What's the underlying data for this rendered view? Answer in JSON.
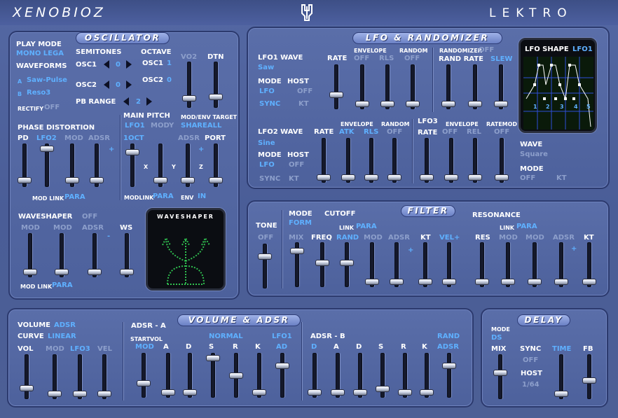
{
  "header": {
    "logo": "XENOBIOZ",
    "brand": "LEKTRO"
  },
  "osc": {
    "title": "OSCILLATOR",
    "play_mode": "PLAY MODE",
    "play_mode_val": "MONO LEGA",
    "waveforms": "WAVEFORMS",
    "wave_a_key": "A",
    "wave_a": "Saw-Pulse",
    "wave_b_key": "B",
    "wave_b": "Reso3",
    "rectify": "RECTIFY",
    "rectify_val": "OFF",
    "semitones": "SEMITONES",
    "octave": "OCTAVE",
    "osc1": "OSC1",
    "osc2": "OSC2",
    "osc1_semi": "0",
    "osc2_semi": "0",
    "osc1_oct": "1",
    "osc2_oct": "0",
    "pb_range": "PB RANGE",
    "pb_val": "2",
    "vo2": "VO2",
    "dtn": "DTN",
    "main_pitch": "MAIN PITCH",
    "mp_lfo": "LFO1",
    "mp_mody": "MODY",
    "mod_env_target": "MOD/ENV TARGET",
    "mod_env_val": "SHAREALL",
    "oct1": "1OCT",
    "adsr": "ADSR",
    "port": "PORT",
    "x": "X",
    "y": "Y",
    "z": "Z",
    "plus": "+",
    "modlink": "MODLINK",
    "modlink_val": "PARA",
    "env": "ENV",
    "env_val": "IN",
    "phase_dist": "PHASE DISTORTION",
    "pd": "PD",
    "pd_lfo": "LFO2",
    "pd_mod": "MOD",
    "pd_adsr": "ADSR",
    "pd_modlink": "MOD LINK",
    "pd_modlink_val": "PARA",
    "waveshaper": "WAVESHAPER",
    "ws_off": "OFF",
    "ws_mod1": "MOD",
    "ws_mod2": "MOD",
    "ws_adsr": "ADSR",
    "ws": "WS",
    "minus": "-",
    "ws_modlink": "MOD LINK",
    "ws_modlink_val": "PARA",
    "ws_display": "WAVESHAPER"
  },
  "lfo": {
    "title": "LFO & RANDOMIZER",
    "lfo1_wave": "LFO1 WAVE",
    "lfo1_wave_val": "Saw",
    "rate": "RATE",
    "envelope": "ENVELOPE",
    "random": "RANDOM",
    "env_off": "OFF",
    "rls": "RLS",
    "rnd_off": "OFF",
    "randomizer": "RANDOMIZER",
    "randomizer_val": "OFF",
    "rand_rate": "RAND RATE",
    "slew": "SLEW",
    "mode": "MODE",
    "host": "HOST",
    "mode_val": "LFO",
    "host_val": "OFF",
    "sync": "SYNC",
    "kt": "KT",
    "lfo2_wave": "LFO2 WAVE",
    "lfo2_wave_val": "Sine",
    "atk": "ATK",
    "rls2": "RLS",
    "off2": "OFF",
    "lfo3": "LFO3",
    "envelope3": "ENVELOPE",
    "ratemod": "RATEMOD",
    "lfo3_off1": "OFF",
    "lfo3_rel": "REL",
    "lfo3_off2": "OFF",
    "wave": "WAVE",
    "wave_val": "Square",
    "mode3": "MODE",
    "mode3_off": "OFF",
    "kt3": "KT",
    "shape_label": "LFO SHAPE",
    "shape_sel": "LFO1",
    "shape_nums": [
      "1",
      "2",
      "3",
      "4",
      "5"
    ]
  },
  "filter": {
    "title": "FILTER",
    "tone": "TONE",
    "tone_off": "OFF",
    "mode": "MODE",
    "mode_val": "FORM",
    "cutoff": "CUTOFF",
    "link": "LINK",
    "link_val": "PARA",
    "resonance": "RESONANCE",
    "res_link": "LINK",
    "res_link_val": "PARA",
    "mix": "MIX",
    "freq": "FREQ",
    "rand": "RAND",
    "mod": "MOD",
    "adsr": "ADSR",
    "kt": "KT",
    "velp": "VEL+",
    "res": "RES",
    "mod1": "MOD",
    "mod2": "MOD",
    "adsr2": "ADSR",
    "kt2": "KT"
  },
  "vol": {
    "title": "VOLUME & ADSR",
    "volume": "VOLUME",
    "volume_val": "ADSR",
    "curve": "CURVE",
    "curve_val": "LINEAR",
    "vol": "VOL",
    "mod": "MOD",
    "lfo3": "LFO3",
    "vel": "VEL",
    "adsr_a": "ADSR - A",
    "startvol": "STARTVOL",
    "normal": "NORMAL",
    "lfo1": "LFO1",
    "mod2": "MOD",
    "a": "A",
    "d": "D",
    "s": "S",
    "r": "R",
    "k": "K",
    "ad": "AD",
    "adsr_b": "ADSR - B",
    "rand": "RAND",
    "adsr_v": "ADSR",
    "d_b": "D"
  },
  "delay": {
    "title": "DELAY",
    "mode": "MODE",
    "mode_val": "DS",
    "mix": "MIX",
    "sync": "SYNC",
    "sync_val": "OFF",
    "time": "TIME",
    "fb": "FB",
    "host": "HOST",
    "host_val": "1/64"
  },
  "sliders": {
    "osc_vo2": 0.15,
    "osc_dtn": 0.2,
    "pd": 0.1,
    "pd_lfo2": 0.95,
    "pd_mod": 0.1,
    "pd_adsr": 0.1,
    "mp_1oct": 0.85,
    "mp_y": 0.1,
    "mp_adsr": 0.1,
    "mp_port": 0.1,
    "ws_mod1": 0.05,
    "ws_mod2": 0.05,
    "ws_adsr": 0.05,
    "ws_ws": 0.05,
    "lfo1_rate": 0.3,
    "lfo1_env1": 0.05,
    "lfo1_env2": 0.05,
    "lfo1_rnd": 0.05,
    "rand_rate": 0.05,
    "rand_r2": 0.05,
    "rand_slew": 0.05,
    "lfo2_rate": 0.05,
    "lfo2_atk": 0.05,
    "lfo2_rls": 0.05,
    "lfo2_off": 0.05,
    "lfo3_rate": 0.05,
    "lfo3_e1": 0.05,
    "lfo3_e2": 0.05,
    "lfo3_rm": 0.05,
    "tone": 0.75,
    "f_mix": 0.85,
    "f_freq": 0.55,
    "f_rand": 0.55,
    "f_mod": 0.05,
    "f_adsr": 0.05,
    "f_kt": 0.05,
    "f_vel": 0.05,
    "f_res": 0.05,
    "f_mod1": 0.05,
    "f_mod2": 0.05,
    "f_adsr2": 0.05,
    "f_kt2": 0.05,
    "v_vol": 0.2,
    "v_mod": 0.05,
    "v_lfo3": 0.05,
    "v_vel": 0.05,
    "a_sv": 0.3,
    "a_a": 0.05,
    "a_d": 0.05,
    "a_s": 0.95,
    "a_r": 0.5,
    "a_k": 0.05,
    "a_lfo": 0.75,
    "b_d": 0.05,
    "b_a": 0.05,
    "b_dd": 0.05,
    "b_s": 0.15,
    "b_r": 0.05,
    "b_k": 0.05,
    "b_rand": 0.75,
    "d_mix": 0.6,
    "d_time": 0.05,
    "d_fb": 0.4
  }
}
